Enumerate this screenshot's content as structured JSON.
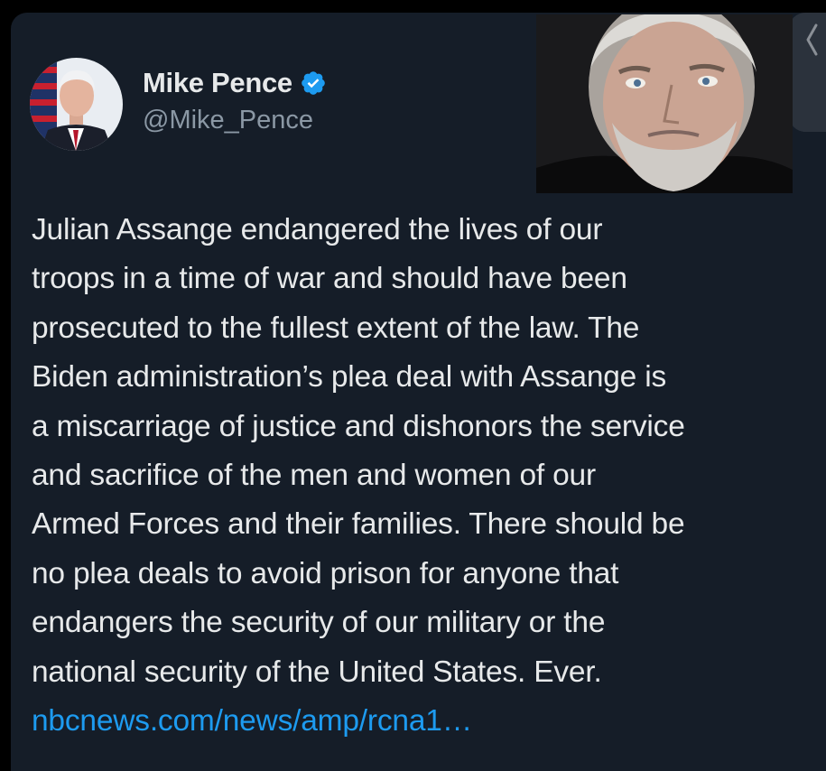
{
  "tweet": {
    "author": {
      "display_name": "Mike Pence",
      "handle": "@Mike_Pence",
      "verified": true,
      "verified_color": "#1d9bf0"
    },
    "text_lines": [
      "Julian Assange endangered the lives of our",
      "troops in a time of war and should have been",
      "prosecuted to the fullest extent of the law. The",
      "Biden administration’s plea deal with Assange is",
      "a miscarriage of justice and dishonors the service",
      "and sacrifice of the men and women of our",
      "Armed Forces and their families. There should be",
      "no plea deals to avoid prison for anyone that",
      "endangers the security of our military or the",
      "national security of the United States. Ever."
    ],
    "link": "nbcnews.com/news/amp/rcna1…"
  },
  "icons": {
    "verified": "verified-badge-icon",
    "side": "chevron-left-icon"
  },
  "colors": {
    "background": "#151d28",
    "text": "#e7e9ea",
    "secondary": "#8b98a5",
    "link": "#1d9bf0"
  }
}
